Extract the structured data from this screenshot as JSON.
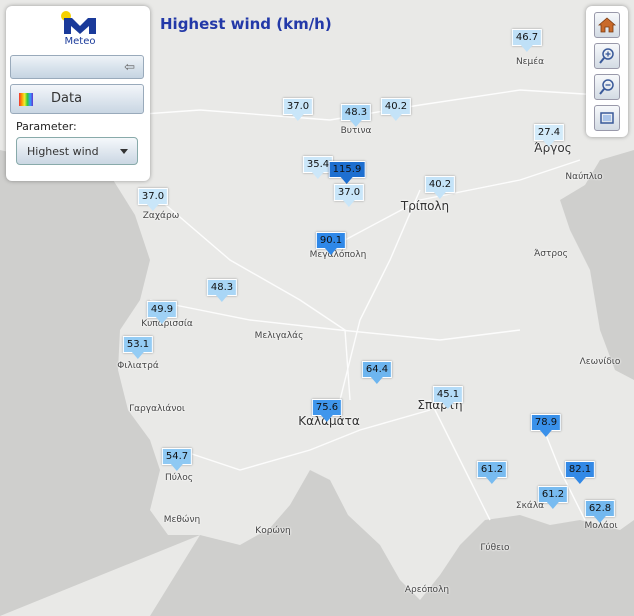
{
  "title": "Highest wind (km/h)",
  "panel": {
    "logo_text": "Meteo",
    "data_button_label": "Data",
    "parameter_label": "Parameter:",
    "parameter_value": "Highest wind"
  },
  "toolbar": {
    "home_icon": "home-icon",
    "zoom_in_icon": "zoom-in-icon",
    "zoom_out_icon": "zoom-out-icon",
    "fullscreen_icon": "fullscreen-icon"
  },
  "places": [
    {
      "name": "Νεμέα"
    },
    {
      "name": "Άργος"
    },
    {
      "name": "Βυτινα"
    },
    {
      "name": "Ναύπλιο"
    },
    {
      "name": "Ζαχάρω"
    },
    {
      "name": "Τρίπολη"
    },
    {
      "name": "Μεγαλόπολη"
    },
    {
      "name": "Άστρος"
    },
    {
      "name": "Κυπαρισσία"
    },
    {
      "name": "Μελιγαλάς"
    },
    {
      "name": "Φιλιατρά"
    },
    {
      "name": "Λεωνίδιο"
    },
    {
      "name": "Γαργαλιάνοι"
    },
    {
      "name": "Καλαμάτα"
    },
    {
      "name": "Σπάρτη"
    },
    {
      "name": "Πύλος"
    },
    {
      "name": "Μεθώνη"
    },
    {
      "name": "Κορώνη"
    },
    {
      "name": "Σκάλα"
    },
    {
      "name": "Μολάοι"
    },
    {
      "name": "Γύθειο"
    },
    {
      "name": "Αρεόπολη"
    }
  ],
  "stations": [
    {
      "value": "46.7",
      "color": "#bfe0f7"
    },
    {
      "value": "27.4",
      "color": "#d3ebfa"
    },
    {
      "value": "37.0",
      "color": "#c9e6f9"
    },
    {
      "value": "48.3",
      "color": "#a9d6f6"
    },
    {
      "value": "40.2",
      "color": "#c4e3f8"
    },
    {
      "value": "35.4",
      "color": "#cce7f9"
    },
    {
      "value": "115.9",
      "color": "#1e6fd0"
    },
    {
      "value": "37.0",
      "color": "#c9e6f9"
    },
    {
      "value": "40.2",
      "color": "#c4e3f8"
    },
    {
      "value": "37.0",
      "color": "#c9e6f9"
    },
    {
      "value": "90.1",
      "color": "#2f88e8"
    },
    {
      "value": "48.3",
      "color": "#a9d6f6"
    },
    {
      "value": "49.9",
      "color": "#9fd1f5"
    },
    {
      "value": "53.1",
      "color": "#94ccf4"
    },
    {
      "value": "64.4",
      "color": "#6db5ef"
    },
    {
      "value": "45.1",
      "color": "#b4dbf7"
    },
    {
      "value": "75.6",
      "color": "#3f96ec"
    },
    {
      "value": "78.9",
      "color": "#3a91ea"
    },
    {
      "value": "54.7",
      "color": "#8fc9f3"
    },
    {
      "value": "61.2",
      "color": "#78bbf0"
    },
    {
      "value": "82.1",
      "color": "#3389e6"
    },
    {
      "value": "61.2",
      "color": "#78bbf0"
    },
    {
      "value": "62.8",
      "color": "#73b8ef"
    }
  ]
}
